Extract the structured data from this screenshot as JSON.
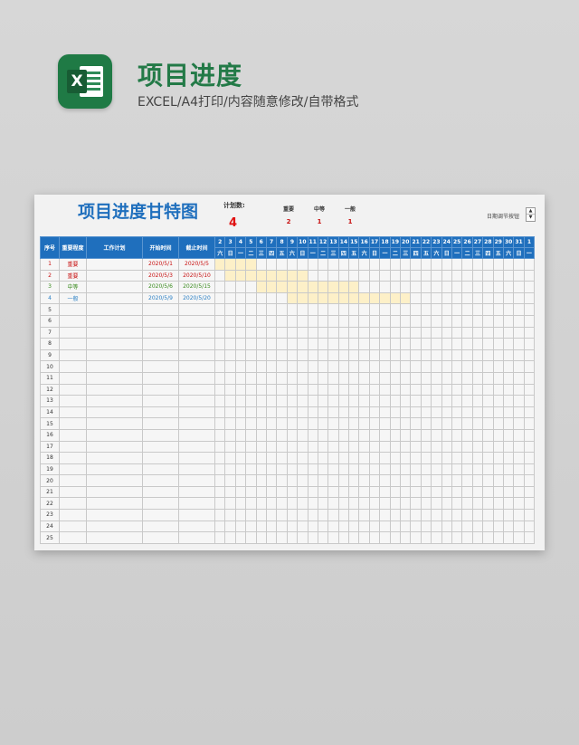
{
  "header": {
    "title": "项目进度",
    "subtitle": "EXCEL/A4打印/内容随意修改/自带格式",
    "logo_letter": "X"
  },
  "sheet": {
    "title": "项目进度甘特图",
    "plan_label": "计划数:",
    "plan_count": "4",
    "levels": [
      {
        "label": "重要",
        "count": "2"
      },
      {
        "label": "中等",
        "count": "1"
      },
      {
        "label": "一般",
        "count": "1"
      }
    ],
    "date_adjust_label": "日期调节按钮",
    "spinner_up": "▲",
    "spinner_down": "▼",
    "columns": [
      "序号",
      "重要程度",
      "工作计划",
      "开始时间",
      "截止时间"
    ],
    "days": [
      "2",
      "3",
      "4",
      "5",
      "6",
      "7",
      "8",
      "9",
      "10",
      "11",
      "12",
      "13",
      "14",
      "15",
      "16",
      "17",
      "18",
      "19",
      "20",
      "21",
      "22",
      "23",
      "24",
      "25",
      "26",
      "27",
      "28",
      "29",
      "30",
      "31",
      "1"
    ],
    "weekdays": [
      "六",
      "日",
      "一",
      "二",
      "三",
      "四",
      "五",
      "六",
      "日",
      "一",
      "二",
      "三",
      "四",
      "五",
      "六",
      "日",
      "一",
      "二",
      "三",
      "四",
      "五",
      "六",
      "日",
      "一",
      "二",
      "三",
      "四",
      "五",
      "六",
      "日",
      "一"
    ],
    "tasks": [
      {
        "no": "1",
        "level": "重要",
        "plan": "",
        "start": "2020/5/1",
        "end": "2020/5/5",
        "color": "red",
        "bar_start": 0,
        "bar_end": 3
      },
      {
        "no": "2",
        "level": "重要",
        "plan": "",
        "start": "2020/5/3",
        "end": "2020/5/10",
        "color": "red",
        "bar_start": 1,
        "bar_end": 8
      },
      {
        "no": "3",
        "level": "中等",
        "plan": "",
        "start": "2020/5/6",
        "end": "2020/5/15",
        "color": "green",
        "bar_start": 4,
        "bar_end": 13
      },
      {
        "no": "4",
        "level": "一般",
        "plan": "",
        "start": "2020/5/9",
        "end": "2020/5/20",
        "color": "blue",
        "bar_start": 7,
        "bar_end": 18
      }
    ],
    "row_numbers": [
      "5",
      "6",
      "7",
      "8",
      "9",
      "10",
      "11",
      "12",
      "13",
      "14",
      "15",
      "16",
      "17",
      "18",
      "19",
      "20",
      "21",
      "22",
      "23",
      "24",
      "25"
    ]
  }
}
